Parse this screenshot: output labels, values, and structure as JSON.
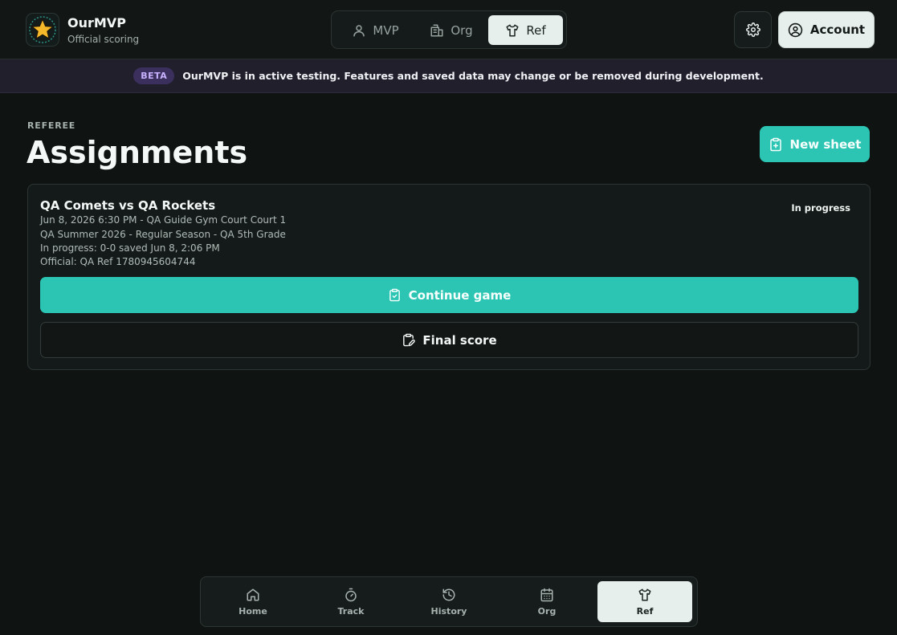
{
  "app": {
    "title": "OurMVP",
    "subtitle": "Official scoring"
  },
  "mode_switch": {
    "items": [
      {
        "label": "MVP",
        "icon": "user-icon",
        "active": false
      },
      {
        "label": "Org",
        "icon": "building-icon",
        "active": false
      },
      {
        "label": "Ref",
        "icon": "jersey-icon",
        "active": true
      }
    ]
  },
  "header": {
    "account_label": "Account"
  },
  "banner": {
    "badge": "BETA",
    "text": "OurMVP is in active testing. Features and saved data may change or be removed during development."
  },
  "page": {
    "eyebrow": "REFEREE",
    "title": "Assignments",
    "new_sheet_label": "New sheet"
  },
  "assignment": {
    "title": "QA Comets vs QA Rockets",
    "status": "In progress",
    "meta": [
      "Jun 8, 2026 6:30 PM - QA Guide Gym Court Court 1",
      "QA Summer 2026 - Regular Season - QA 5th Grade",
      "In progress: 0-0 saved Jun 8, 2:06 PM",
      "Official: QA Ref 1780945604744"
    ],
    "continue_label": "Continue game",
    "final_label": "Final score"
  },
  "bottom_nav": {
    "items": [
      {
        "label": "Home",
        "icon": "home-icon",
        "active": false
      },
      {
        "label": "Track",
        "icon": "stopwatch-icon",
        "active": false
      },
      {
        "label": "History",
        "icon": "history-icon",
        "active": false
      },
      {
        "label": "Org",
        "icon": "calendar-icon",
        "active": false
      },
      {
        "label": "Ref",
        "icon": "jersey-icon",
        "active": true
      }
    ]
  },
  "colors": {
    "accent": "#2cc5b3",
    "background": "#0f1413",
    "banner_bg": "#201f2b",
    "beta_badge": "#3b2f5e"
  }
}
